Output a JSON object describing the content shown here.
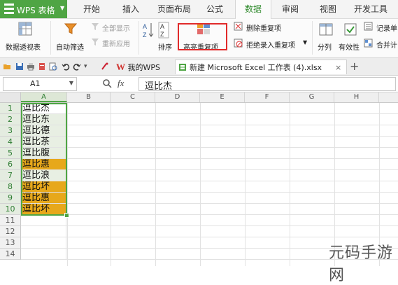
{
  "app": {
    "title": "WPS 表格",
    "colors": {
      "brand": "#4fa544",
      "highlight": "#e7a81b",
      "redbox": "#e12a2a"
    }
  },
  "menu": {
    "tabs": [
      "开始",
      "插入",
      "页面布局",
      "公式",
      "数据",
      "审阅",
      "视图",
      "开发工具"
    ],
    "active": "数据"
  },
  "ribbon": {
    "pivot": "数据透视表",
    "autofilter": "自动筛选",
    "show_all": "全部显示",
    "reapply": "重新应用",
    "sort": "排序",
    "highlight_dup": "高亮重复项",
    "delete_dup": "删除重复项",
    "reject_dup": "拒绝录入重复项",
    "split": "分列",
    "validation": "有效性",
    "record_form": "记录单",
    "merge_calc": "合并计",
    "icons": [
      "pivot-table-icon",
      "filter-icon",
      "sort-az-icon",
      "sort-za-icon",
      "highlight-duplicates-icon",
      "delete-duplicates-icon",
      "reject-duplicates-icon",
      "split-columns-icon",
      "validation-icon",
      "record-form-icon",
      "merge-calc-icon"
    ]
  },
  "tabs": {
    "my_wps": "我的WPS",
    "file": "新建 Microsoft Excel 工作表 (4).xlsx"
  },
  "formula": {
    "namebox": "A1",
    "fx": "fx",
    "value": "逗比杰"
  },
  "grid": {
    "columns": [
      "A",
      "B",
      "C",
      "D",
      "E",
      "F",
      "G",
      "H"
    ],
    "rows": [
      "1",
      "2",
      "3",
      "4",
      "5",
      "6",
      "7",
      "8",
      "9",
      "10",
      "11",
      "12",
      "13",
      "14"
    ],
    "cells": [
      "逗比杰",
      "逗比东",
      "逗比德",
      "逗比茶",
      "逗比腹",
      "逗比惠",
      "逗比浪",
      "逗比坏",
      "逗比惠",
      "逗比坏"
    ],
    "highlighted_rows": [
      6,
      8,
      9,
      10
    ]
  },
  "watermark": "元码手游网"
}
